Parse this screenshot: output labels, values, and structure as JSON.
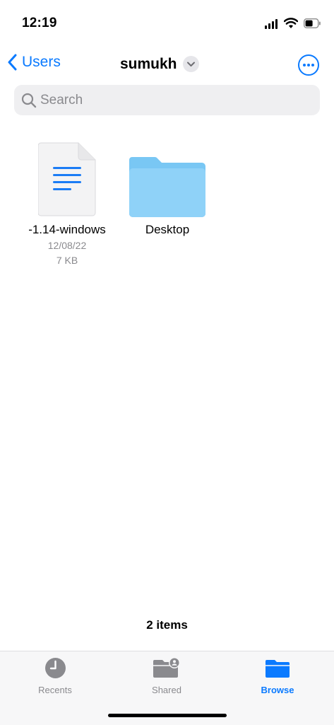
{
  "status": {
    "time": "12:19"
  },
  "nav": {
    "back_label": "Users",
    "title": "sumukh"
  },
  "search": {
    "placeholder": "Search"
  },
  "files": [
    {
      "name": "-1.14-windows",
      "date": "12/08/22",
      "size": "7 KB",
      "type": "document"
    },
    {
      "name": "Desktop",
      "type": "folder"
    }
  ],
  "footer": {
    "count": "2 items"
  },
  "tabs": [
    {
      "label": "Recents",
      "icon": "clock-icon",
      "active": false
    },
    {
      "label": "Shared",
      "icon": "shared-folder-icon",
      "active": false
    },
    {
      "label": "Browse",
      "icon": "folder-icon",
      "active": true
    }
  ],
  "colors": {
    "accent": "#0a7aff",
    "folder": "#8fd2f8",
    "inactive_tab": "#8a8a8e"
  }
}
